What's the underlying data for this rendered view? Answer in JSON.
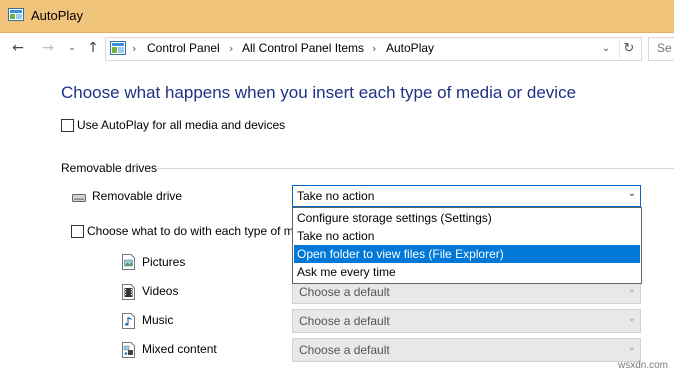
{
  "window": {
    "title": "AutoPlay",
    "titlebar_color": "#f1c47b"
  },
  "nav": {
    "back_icon": "back-arrow-icon",
    "forward_icon": "forward-arrow-icon",
    "history_icon": "chevron-down-icon",
    "up_icon": "up-arrow-icon",
    "breadcrumbs": [
      "Control Panel",
      "All Control Panel Items",
      "AutoPlay"
    ],
    "search_placeholder": "Se"
  },
  "main": {
    "heading": "Choose what happens when you insert each type of media or device",
    "use_autoplay_label": "Use AutoPlay for all media and devices",
    "use_autoplay_checked": false,
    "section_label": "Removable drives",
    "removable_drive_label": "Removable drive",
    "removable_drive_selected": "Take no action",
    "dropdown_options": [
      "Configure storage settings (Settings)",
      "Take no action",
      "Open folder to view files (File Explorer)",
      "Ask me every time"
    ],
    "highlighted_option_index": 2,
    "choose_each_label": "Choose what to do with each type of m",
    "media_types": [
      {
        "label": "Pictures",
        "icon": "pictures-icon",
        "value": "Choose a default"
      },
      {
        "label": "Videos",
        "icon": "videos-icon",
        "value": "Choose a default"
      },
      {
        "label": "Music",
        "icon": "music-icon",
        "value": "Choose a default"
      },
      {
        "label": "Mixed content",
        "icon": "mixed-content-icon",
        "value": "Choose a default"
      }
    ],
    "accent_color": "#0078d7",
    "heading_color": "#1e3287"
  },
  "watermark": "wsxdn.com"
}
